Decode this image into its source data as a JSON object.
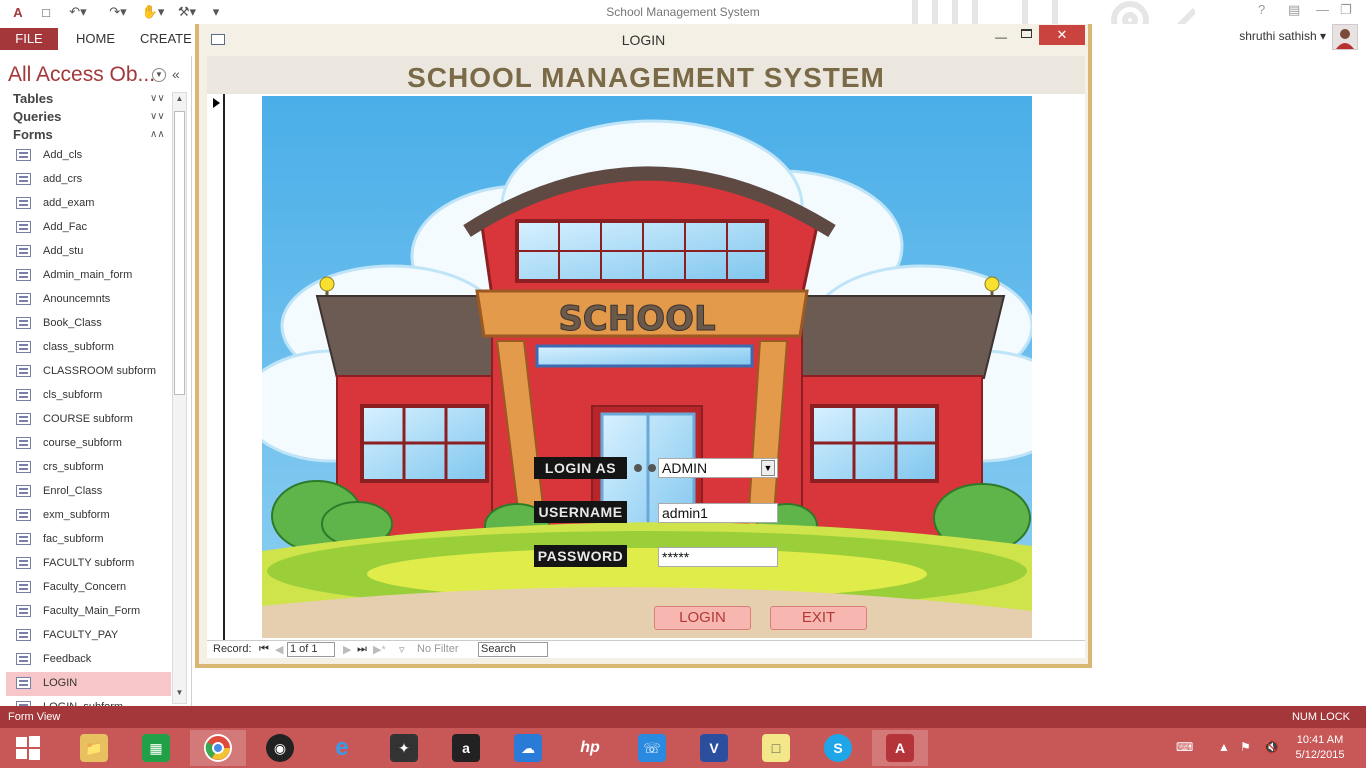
{
  "app_title": "School Management System",
  "user_name": "shruthi sathish",
  "ribbon_tabs": [
    "FILE",
    "HOME",
    "CREATE"
  ],
  "nav": {
    "title": "All Access Ob...",
    "groups": {
      "tables": "Tables",
      "queries": "Queries",
      "forms": "Forms"
    },
    "forms": [
      "Add_cls",
      "add_crs",
      "add_exam",
      "Add_Fac",
      "Add_stu",
      "Admin_main_form",
      "Anouncemnts",
      "Book_Class",
      "class_subform",
      "CLASSROOM subform",
      "cls_subform",
      "COURSE subform",
      "course_subform",
      "crs_subform",
      "Enrol_Class",
      "exm_subform",
      "fac_subform",
      "FACULTY subform",
      "Faculty_Concern",
      "Faculty_Main_Form",
      "FACULTY_PAY",
      "Feedback",
      "LOGIN",
      "LOGIN_subform"
    ],
    "selected": "LOGIN"
  },
  "form_window": {
    "title": "LOGIN",
    "header": "SCHOOL MANAGEMENT SYSTEM",
    "sign_text": "SCHOOL",
    "login_as_label": "LOGIN AS",
    "login_as_value": "ADMIN",
    "username_label": "USERNAME",
    "username_value": "admin1",
    "password_label": "PASSWORD",
    "password_value": "*****",
    "login_button": "LOGIN",
    "exit_button": "EXIT"
  },
  "record_nav": {
    "label": "Record:",
    "position": "1 of 1",
    "filter": "No Filter",
    "search": "Search"
  },
  "status": {
    "left": "Form View",
    "right": "NUM LOCK"
  },
  "clock": {
    "time": "10:41 AM",
    "date": "5/12/2015"
  },
  "colors": {
    "accent": "#a4373a",
    "taskbar": "#c85858",
    "header_text": "#7a6a47",
    "button_fill": "#f7b6b0"
  }
}
